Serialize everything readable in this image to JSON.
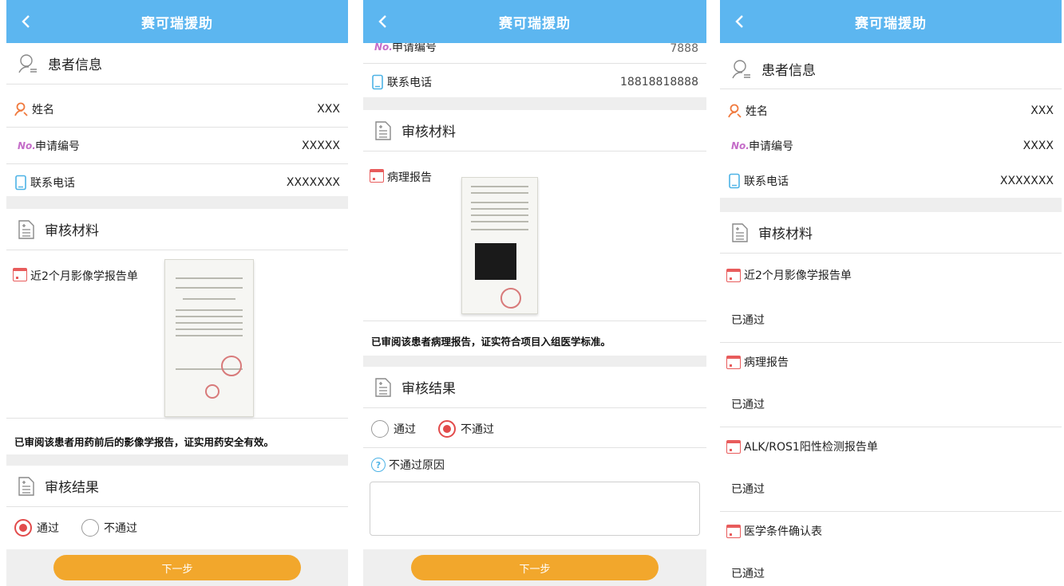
{
  "app_title": "赛可瑞援助",
  "colors": {
    "topbar": "#5cb6f0",
    "accent_red": "#e24b4b",
    "button": "#f2a72c"
  },
  "screen1": {
    "patient_header": "患者信息",
    "rows": [
      {
        "label": "姓名",
        "value": "XXX",
        "icon": "person-icon"
      },
      {
        "label": "申请编号",
        "value": "XXXXX",
        "icon": "number-icon"
      },
      {
        "label": "联系电话",
        "value": "XXXXXXX",
        "icon": "phone-icon"
      }
    ],
    "number_prefix": "No.",
    "review_header": "审核材料",
    "doc_label": "近2个月影像学报告单",
    "note": "已审阅该患者用药前后的影像学报告，证实用药安全有效。",
    "result_header": "审核结果",
    "options": {
      "pass": "通过",
      "fail": "不通过",
      "selected": "pass"
    },
    "next": "下一步"
  },
  "screen2": {
    "partial_row": {
      "label": "申请编号",
      "value": "7888"
    },
    "phone_row": {
      "label": "联系电话",
      "value": "18818818888"
    },
    "number_prefix": "No.",
    "review_header": "审核材料",
    "doc_label": "病理报告",
    "note": "已审阅该患者病理报告，证实符合项目入组医学标准。",
    "result_header": "审核结果",
    "options": {
      "pass": "通过",
      "fail": "不通过",
      "selected": "fail"
    },
    "reason_label": "不通过原因",
    "next": "下一步"
  },
  "screen3": {
    "patient_header": "患者信息",
    "rows": [
      {
        "label": "姓名",
        "value": "XXX"
      },
      {
        "label": "申请编号",
        "value": "XXXX"
      },
      {
        "label": "联系电话",
        "value": "XXXXXXX"
      }
    ],
    "number_prefix": "No.",
    "review_header": "审核材料",
    "docs": [
      {
        "label": "近2个月影像学报告单",
        "status": "已通过"
      },
      {
        "label": "病理报告",
        "status": "已通过"
      },
      {
        "label": "ALK/ROS1阳性检测报告单",
        "status": "已通过"
      },
      {
        "label": "医学条件确认表",
        "status": "已通过"
      }
    ]
  }
}
